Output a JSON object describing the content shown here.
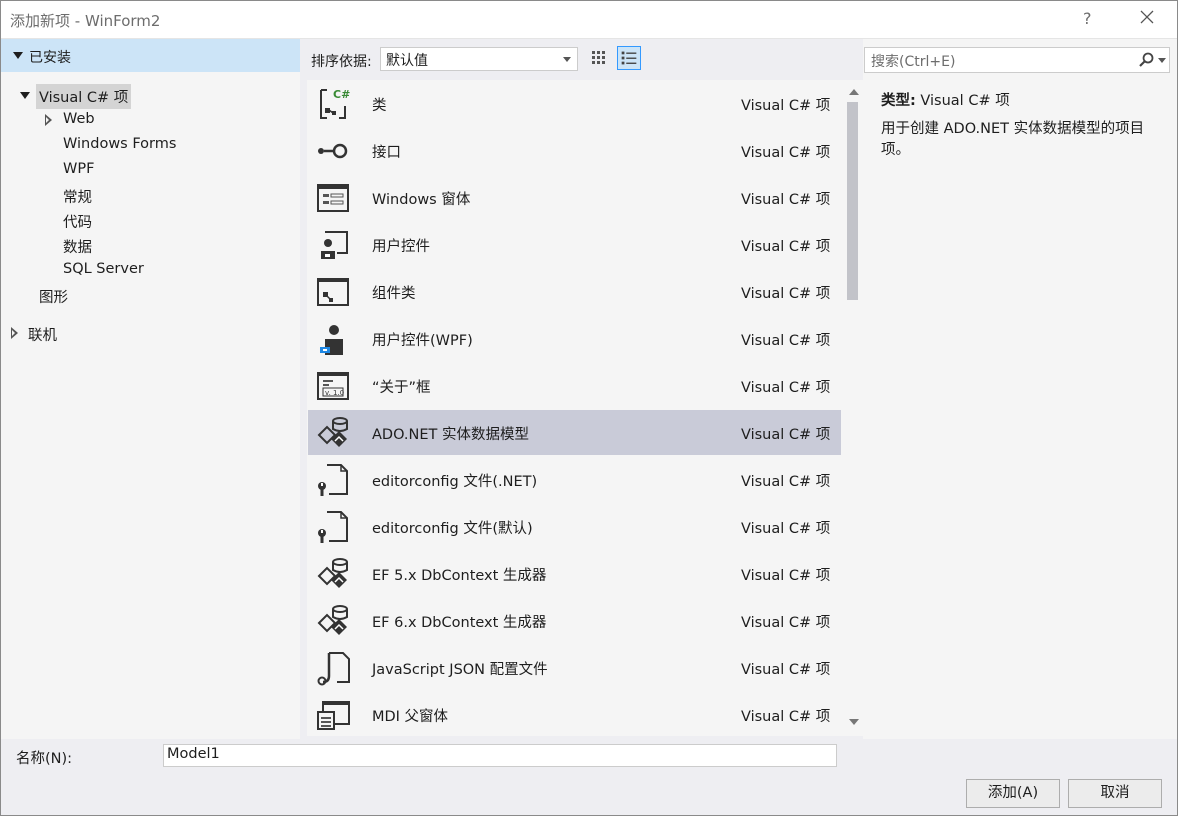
{
  "window": {
    "title": "添加新项 - WinForm2",
    "help_label": "?"
  },
  "left_panel": {
    "installed_label": "已安装",
    "root_node": "Visual C# 项",
    "children": [
      "Web",
      "Windows Forms",
      "WPF",
      "常规",
      "代码",
      "数据",
      "SQL Server"
    ],
    "graphics_label": "图形",
    "online_label": "联机"
  },
  "toolbar": {
    "sort_label": "排序依据:",
    "sort_value": "默认值"
  },
  "items": [
    {
      "name": "类",
      "type": "Visual C# 项",
      "icon": "class-icon"
    },
    {
      "name": "接口",
      "type": "Visual C# 项",
      "icon": "interface-icon"
    },
    {
      "name": "Windows 窗体",
      "type": "Visual C# 项",
      "icon": "windows-form-icon"
    },
    {
      "name": "用户控件",
      "type": "Visual C# 项",
      "icon": "user-control-icon"
    },
    {
      "name": "组件类",
      "type": "Visual C# 项",
      "icon": "component-class-icon"
    },
    {
      "name": "用户控件(WPF)",
      "type": "Visual C# 项",
      "icon": "wpf-user-control-icon"
    },
    {
      "name": "“关于”框",
      "type": "Visual C# 项",
      "icon": "about-box-icon"
    },
    {
      "name": "ADO.NET 实体数据模型",
      "type": "Visual C# 项",
      "icon": "entity-model-icon",
      "selected": true
    },
    {
      "name": "editorconfig 文件(.NET)",
      "type": "Visual C# 项",
      "icon": "config-file-icon"
    },
    {
      "name": "editorconfig 文件(默认)",
      "type": "Visual C# 项",
      "icon": "config-file-icon"
    },
    {
      "name": "EF 5.x DbContext 生成器",
      "type": "Visual C# 项",
      "icon": "entity-model-icon"
    },
    {
      "name": "EF 6.x DbContext 生成器",
      "type": "Visual C# 项",
      "icon": "entity-model-icon"
    },
    {
      "name": "JavaScript JSON 配置文件",
      "type": "Visual C# 项",
      "icon": "json-file-icon"
    },
    {
      "name": "MDI 父窗体",
      "type": "Visual C# 项",
      "icon": "mdi-form-icon"
    }
  ],
  "search": {
    "placeholder": "搜索(Ctrl+E)"
  },
  "details": {
    "type_label": "类型:",
    "type_value": "Visual C# 项",
    "description": "用于创建 ADO.NET 实体数据模型的项目项。"
  },
  "footer": {
    "name_label": "名称(N):",
    "name_value": "Model1",
    "add_label": "添加(A)",
    "cancel_label": "取消"
  }
}
